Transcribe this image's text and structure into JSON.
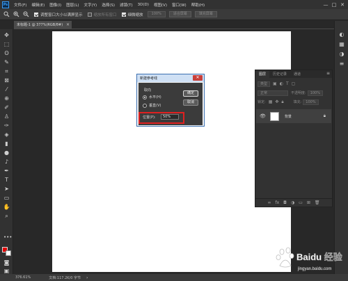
{
  "app": {
    "logo": "Ps"
  },
  "menubar": {
    "items": [
      "文件(F)",
      "编辑(E)",
      "图像(I)",
      "图层(L)",
      "文字(Y)",
      "选择(S)",
      "滤镜(T)",
      "3D(D)",
      "视图(V)",
      "窗口(W)",
      "帮助(H)"
    ],
    "window_controls": [
      "—",
      "□",
      "✕"
    ]
  },
  "options_bar": {
    "resize_windows_label": "调整窗口大小以满屏显示",
    "resize_windows_checked": true,
    "zoom_all_label": "缩放所有窗口",
    "zoom_all_checked": false,
    "scrubby_zoom_label": "细微缩放",
    "scrubby_zoom_checked": true,
    "percent_box": "100%",
    "fit_screen_button": "适合屏幕",
    "fill_screen_button": "填充屏幕"
  },
  "document_tab": {
    "label": "未标题-1 @ 377%(RGB/8#)",
    "close": "×"
  },
  "colors": {
    "foreground": "#e00000",
    "background": "#ffffff",
    "highlight": "#e02020"
  },
  "dialog": {
    "title": "新建参考线",
    "close": "✕",
    "orientation_label": "取向",
    "horizontal_label": "水平(H)",
    "horizontal_selected": true,
    "vertical_label": "垂直(V)",
    "vertical_selected": false,
    "ok_button": "确定",
    "cancel_button": "取消",
    "position_label": "位置(P):",
    "position_value": "50%"
  },
  "layers_panel": {
    "tabs": [
      "图层",
      "历史记录",
      "通道"
    ],
    "active_tab": "图层",
    "filter_placeholder": "类型",
    "blend_mode": "正常",
    "opacity_label": "不透明度:",
    "opacity_value": "100%",
    "lock_label": "锁定:",
    "fill_label": "填充:",
    "fill_value": "100%",
    "layer": {
      "name": "背景",
      "visible": true,
      "locked": true
    }
  },
  "statusbar": {
    "zoom": "376.61%",
    "doc_size": "文档:117.2K/0 字节",
    "arrow": "›"
  },
  "watermark": {
    "text": "Baidu 经验",
    "subtext": "jingyan.baidu.com"
  }
}
